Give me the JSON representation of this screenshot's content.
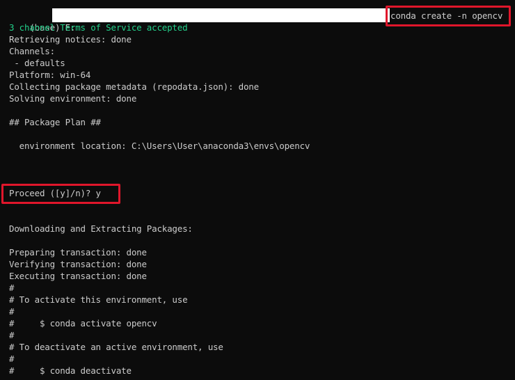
{
  "terminal": {
    "prompt": "(base) E:",
    "command": "conda create -n opencv",
    "lines": [
      "3 channel Terms of Service accepted",
      "Retrieving notices: done",
      "Channels:",
      " - defaults",
      "Platform: win-64",
      "Collecting package metadata (repodata.json): done",
      "Solving environment: done",
      "## Package Plan ##",
      "  environment location: C:\\Users\\User\\anaconda3\\envs\\opencv",
      "Proceed ([y]/n)? y",
      "Downloading and Extracting Packages:",
      "Preparing transaction: done",
      "Verifying transaction: done",
      "Executing transaction: done",
      "#",
      "# To activate this environment, use",
      "#",
      "#     $ conda activate opencv",
      "#",
      "# To deactivate an active environment, use",
      "#",
      "#     $ conda deactivate"
    ]
  },
  "colors": {
    "background": "#0c0c0c",
    "text": "#cccccc",
    "accent_green": "#23d18b",
    "highlight_red": "#e0162b",
    "redaction": "#ffffff"
  }
}
